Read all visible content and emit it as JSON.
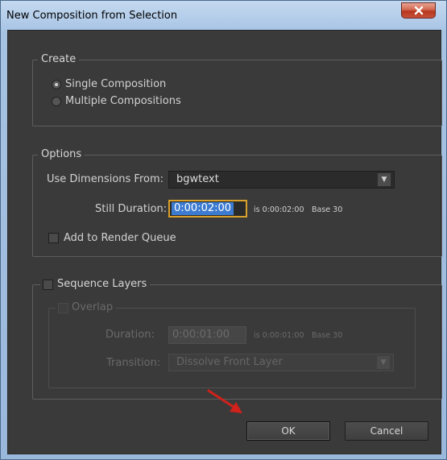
{
  "window": {
    "title": "New Composition from Selection"
  },
  "create_group": {
    "title": "Create",
    "options": [
      {
        "label": "Single Composition",
        "selected": true
      },
      {
        "label": "Multiple Compositions",
        "selected": false
      }
    ]
  },
  "options_group": {
    "title": "Options",
    "use_dimensions_label": "Use Dimensions From:",
    "use_dimensions_value": "bgwtext",
    "still_duration_label": "Still Duration:",
    "still_duration_value": "0:00:02:00",
    "still_duration_info": "is 0:00:02:00",
    "still_duration_base": "Base 30",
    "add_to_render_queue_label": "Add to Render Queue",
    "add_to_render_queue_checked": false
  },
  "sequence_group": {
    "title": "Sequence Layers",
    "checked": false,
    "overlap_label": "Overlap",
    "duration_label": "Duration:",
    "duration_value": "0:00:01:00",
    "duration_info": "is 0:00:01:00",
    "duration_base": "Base 30",
    "transition_label": "Transition:",
    "transition_value": "Dissolve Front Layer"
  },
  "buttons": {
    "ok": "OK",
    "cancel": "Cancel"
  },
  "colors": {
    "panel_bg": "#3a3a3a",
    "focus_outline": "#d9a02a",
    "selection": "#3c7bd0",
    "annotation_arrow": "#d0211b"
  }
}
